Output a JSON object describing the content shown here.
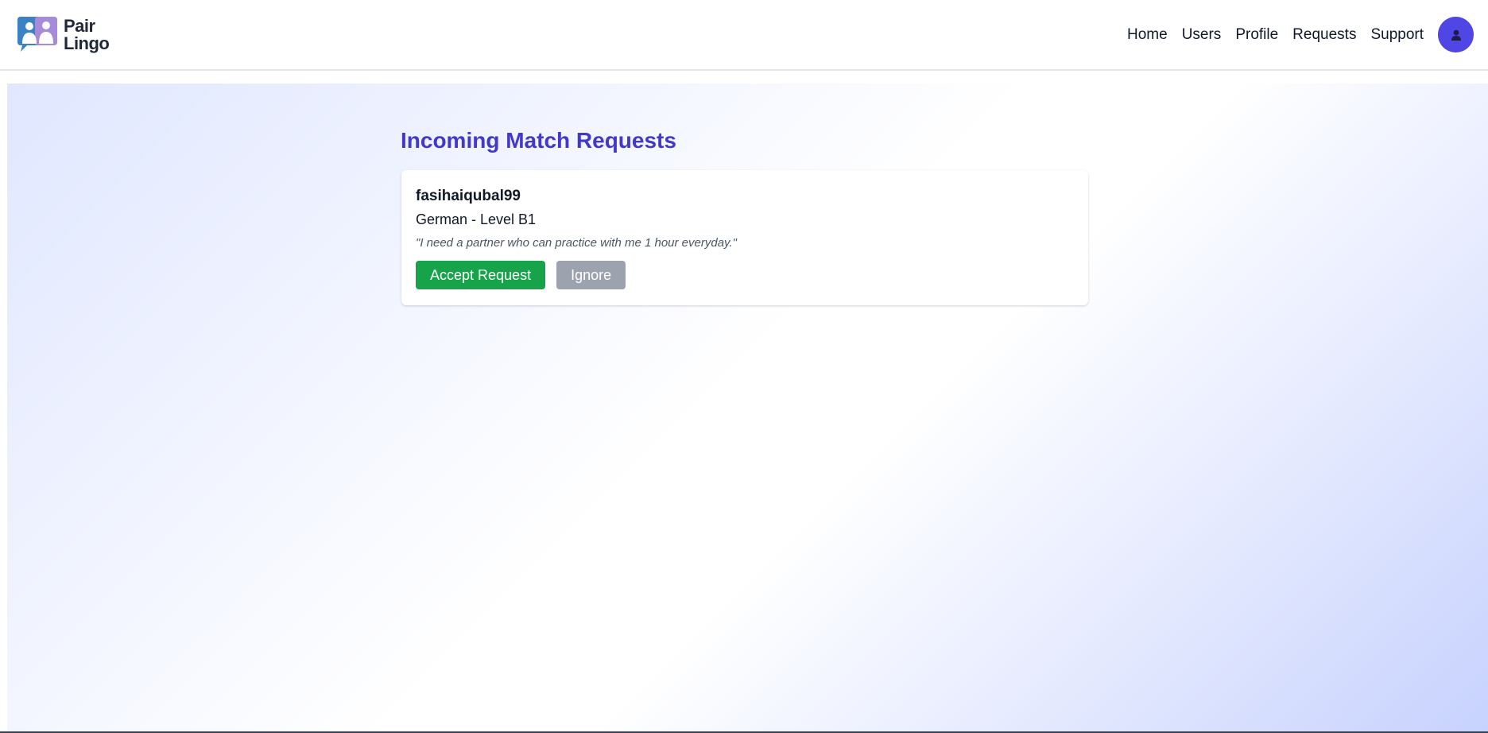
{
  "brand": {
    "line1": "Pair",
    "line2": "Lingo"
  },
  "nav": {
    "links": [
      {
        "label": "Home"
      },
      {
        "label": "Users"
      },
      {
        "label": "Profile"
      },
      {
        "label": "Requests"
      },
      {
        "label": "Support"
      }
    ],
    "avatar_icon": "user-icon"
  },
  "page": {
    "title": "Incoming Match Requests"
  },
  "requests": [
    {
      "username": "fasihaiqubal99",
      "language": "German - Level B1",
      "message": "\"I need a partner who can practice with me 1 hour everyday.\"",
      "accept_label": "Accept Request",
      "ignore_label": "Ignore"
    }
  ],
  "colors": {
    "accent": "#4338ca",
    "avatar": "#4f46e5",
    "accept": "#16a34a",
    "ignore": "#9ca3af"
  }
}
